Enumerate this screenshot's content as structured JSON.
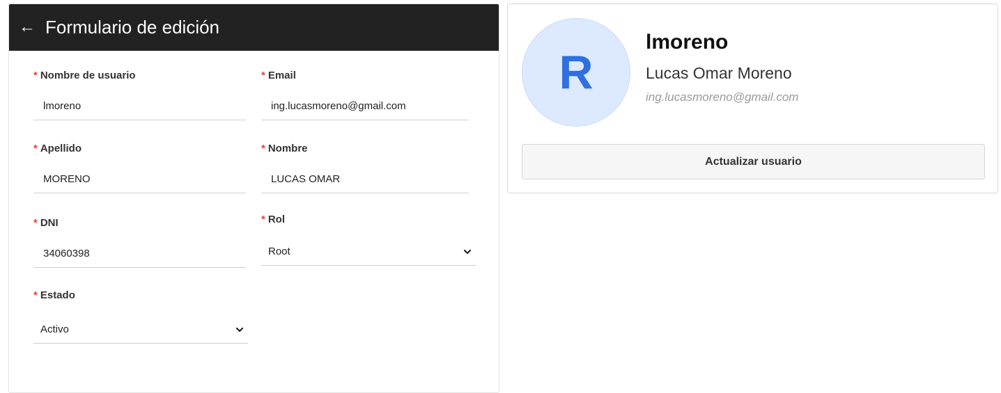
{
  "form": {
    "title": "Formulario de edición",
    "back_icon": "arrow-left-icon",
    "required_mark": "*",
    "fields": {
      "username": {
        "label": "Nombre de usuario",
        "value": "lmoreno"
      },
      "email": {
        "label": "Email",
        "value": "ing.lucasmoreno@gmail.com"
      },
      "lastname": {
        "label": "Apellido",
        "value": "MORENO"
      },
      "firstname": {
        "label": "Nombre",
        "value": "LUCAS OMAR"
      },
      "dni": {
        "label": "DNI",
        "value": "34060398"
      },
      "role": {
        "label": "Rol",
        "selected": "Root"
      },
      "status": {
        "label": "Estado",
        "selected": "Activo"
      }
    }
  },
  "profile": {
    "avatar_letter": "R",
    "username": "lmoreno",
    "fullname": "Lucas Omar Moreno",
    "email": "ing.lucasmoreno@gmail.com",
    "update_button": "Actualizar usuario"
  },
  "colors": {
    "header_bg": "#222222",
    "required": "#e0443a",
    "avatar_bg": "#dce9ff",
    "avatar_letter": "#2f6fe0"
  }
}
